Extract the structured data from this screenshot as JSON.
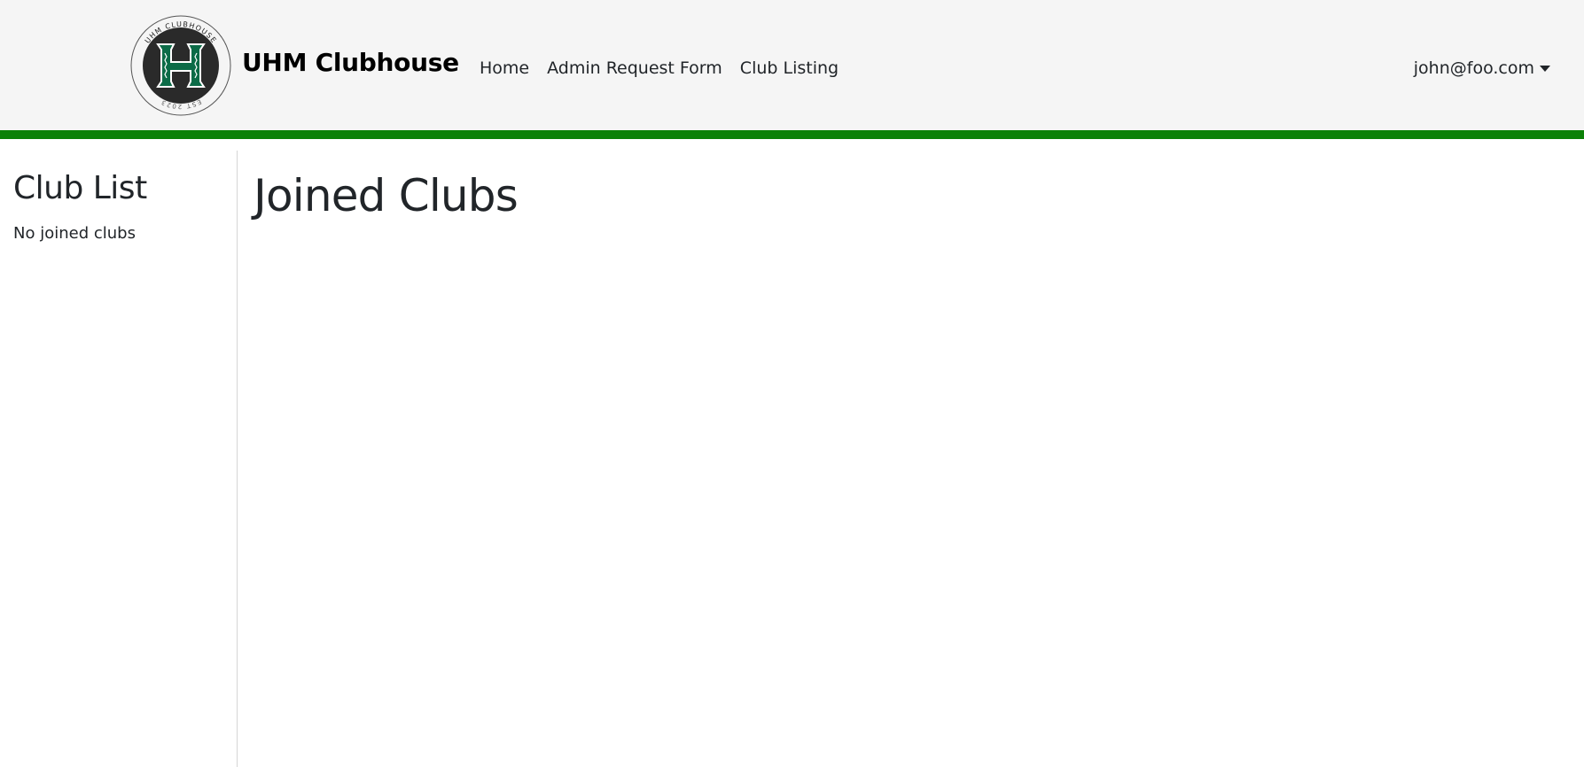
{
  "header": {
    "brand": "UHM Clubhouse",
    "logo_text_top": "UHM CLUBHOUSE",
    "logo_text_bottom": "EST 2023",
    "nav": [
      {
        "label": "Home"
      },
      {
        "label": "Admin Request Form"
      },
      {
        "label": "Club Listing"
      }
    ],
    "user_email": "john@foo.com"
  },
  "sidebar": {
    "title": "Club List",
    "empty_text": "No joined clubs"
  },
  "main": {
    "title": "Joined Clubs"
  },
  "colors": {
    "navbar_bg": "#f5f5f5",
    "accent_green": "#0c8107",
    "logo_dark": "#2a2a2a",
    "logo_h_green": "#0b6b47"
  }
}
